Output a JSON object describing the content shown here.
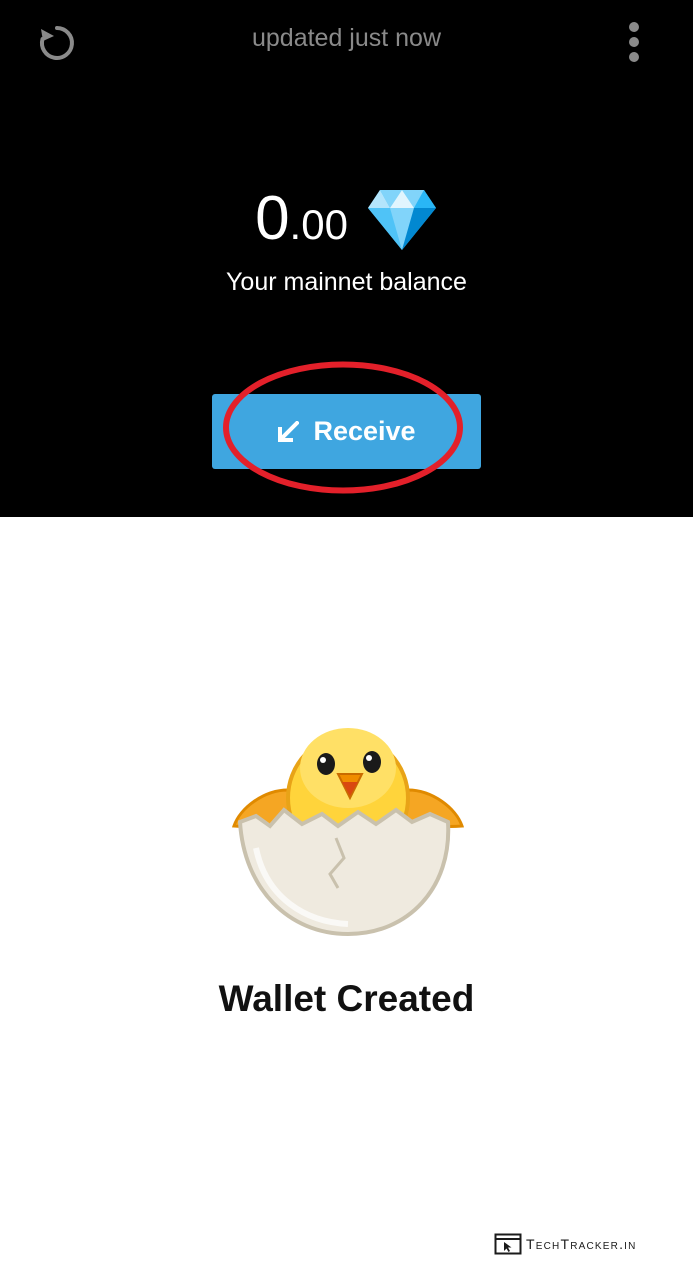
{
  "header": {
    "status_text": "updated just now",
    "refresh_icon": "refresh-icon",
    "menu_icon": "more-vertical-icon"
  },
  "balance": {
    "integer_part": "0",
    "decimal_part": ".00",
    "currency_icon": "diamond-icon",
    "label": "Your mainnet balance"
  },
  "receive_button": {
    "label": "Receive",
    "icon": "arrow-down-left-icon",
    "color": "#3fa6e0"
  },
  "annotation": {
    "ring_color": "#e3202a"
  },
  "empty_state": {
    "illustration": "hatching-chick",
    "title": "Wallet Created"
  },
  "watermark": {
    "text": "TechTracker.in",
    "icon": "browser-cursor-icon"
  }
}
